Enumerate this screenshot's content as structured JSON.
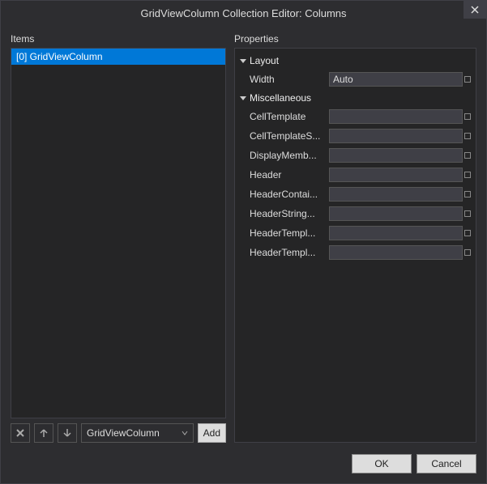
{
  "titlebar": {
    "title": "GridViewColumn Collection Editor: Columns"
  },
  "left": {
    "label": "Items",
    "items": [
      {
        "label": "[0] GridViewColumn",
        "selected": true
      }
    ],
    "type_select": "GridViewColumn",
    "add_label": "Add"
  },
  "right": {
    "label": "Properties",
    "categories": [
      {
        "name": "Layout",
        "rows": [
          {
            "label": "Width",
            "value": "Auto"
          }
        ]
      },
      {
        "name": "Miscellaneous",
        "rows": [
          {
            "label": "CellTemplate",
            "value": ""
          },
          {
            "label": "CellTemplateS...",
            "value": ""
          },
          {
            "label": "DisplayMemb...",
            "value": ""
          },
          {
            "label": "Header",
            "value": ""
          },
          {
            "label": "HeaderContai...",
            "value": ""
          },
          {
            "label": "HeaderString...",
            "value": ""
          },
          {
            "label": "HeaderTempl...",
            "value": ""
          },
          {
            "label": "HeaderTempl...",
            "value": ""
          }
        ]
      }
    ]
  },
  "buttons": {
    "ok": "OK",
    "cancel": "Cancel"
  }
}
